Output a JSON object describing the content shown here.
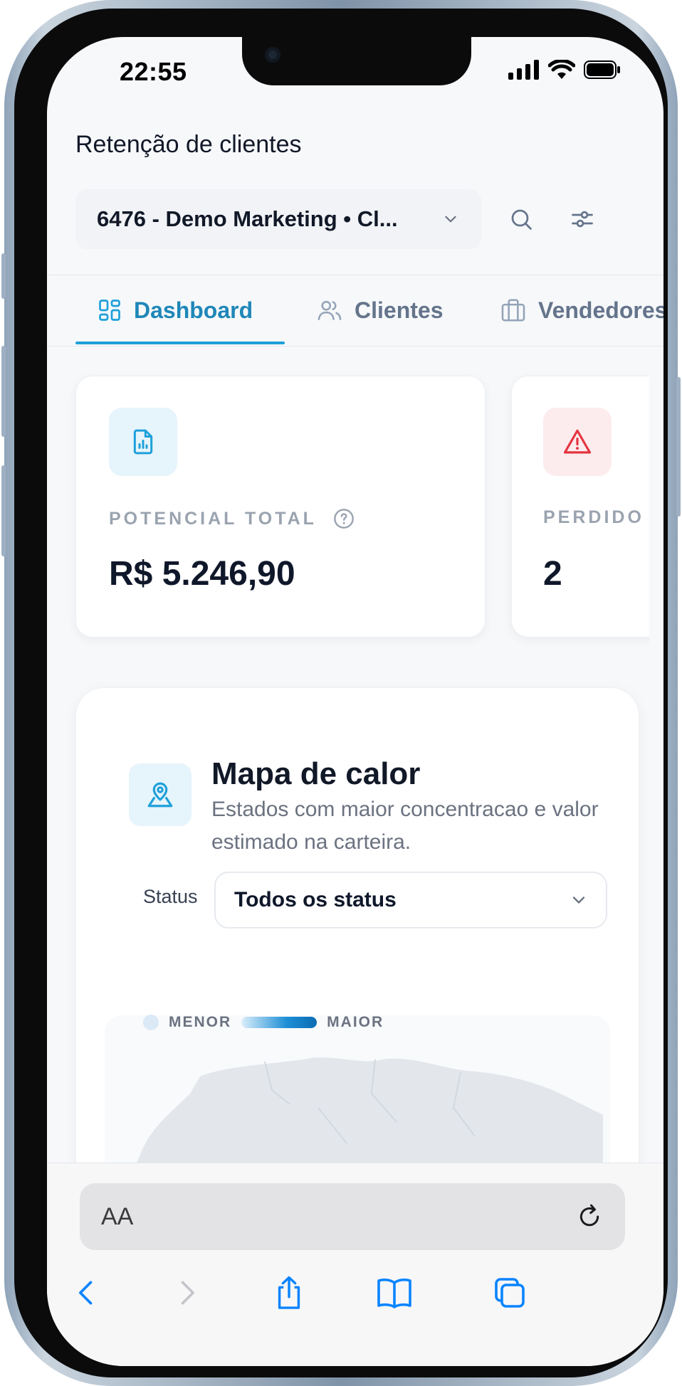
{
  "status_bar": {
    "time": "22:55"
  },
  "header": {
    "title": "Retenção de clientes",
    "store_select": "6476 - Demo Marketing • Cl..."
  },
  "tabs": [
    {
      "label": "Dashboard",
      "icon": "dashboard-grid-icon",
      "active": true
    },
    {
      "label": "Clientes",
      "icon": "users-icon",
      "active": false
    },
    {
      "label": "Vendedores",
      "icon": "briefcase-icon",
      "active": false
    }
  ],
  "kpis": [
    {
      "label": "POTENCIAL TOTAL",
      "value": "R$ 5.246,90",
      "icon": "report-chart-icon",
      "color": "#1ea0da"
    },
    {
      "label": "PERDIDO",
      "value": "2",
      "icon": "warning-icon",
      "color": "#e3343f"
    }
  ],
  "heatmap": {
    "title": "Mapa de calor",
    "subtitle": "Estados com maior concentracao e valor estimado na carteira.",
    "status_label": "Status",
    "status_value": "Todos os status",
    "legend_min": "MENOR",
    "legend_max": "MAIOR"
  },
  "browser": {
    "text_size_label": "AA"
  },
  "colors": {
    "accent": "#1ea0da",
    "danger": "#e3343f",
    "text": "#0f172a",
    "muted": "#9aa3af"
  }
}
